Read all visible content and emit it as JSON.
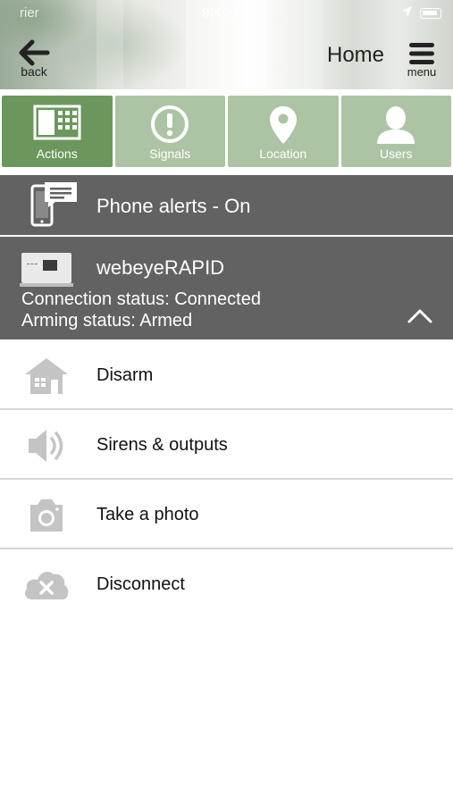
{
  "status_bar": {
    "carrier": "rier",
    "time": "9:40 AM"
  },
  "header": {
    "back_label": "back",
    "title": "Home",
    "menu_label": "menu"
  },
  "tabs": [
    {
      "label": "Actions",
      "icon": "keypad-icon",
      "active": true
    },
    {
      "label": "Signals",
      "icon": "exclamation-icon",
      "active": false
    },
    {
      "label": "Location",
      "icon": "map-pin-icon",
      "active": false
    },
    {
      "label": "Users",
      "icon": "user-icon",
      "active": false
    }
  ],
  "alerts": {
    "label": "Phone alerts - On",
    "icon": "phone-message-icon"
  },
  "device": {
    "name": "webeyeRAPID",
    "connection_status": "Connection status: Connected",
    "arming_status": "Arming status: Armed",
    "icon": "device-panel-icon",
    "toggle_icon": "chevron-up-icon"
  },
  "actions": [
    {
      "label": "Disarm",
      "icon": "house-icon"
    },
    {
      "label": "Sirens & outputs",
      "icon": "speaker-icon"
    },
    {
      "label": "Take a photo",
      "icon": "camera-icon"
    },
    {
      "label": "Disconnect",
      "icon": "cloud-x-icon"
    }
  ],
  "colors": {
    "tab_active": "#6b975c",
    "tab_inactive": "#adc4a4",
    "panel_dark": "#626262",
    "icon_grey": "#c4c4c4"
  }
}
